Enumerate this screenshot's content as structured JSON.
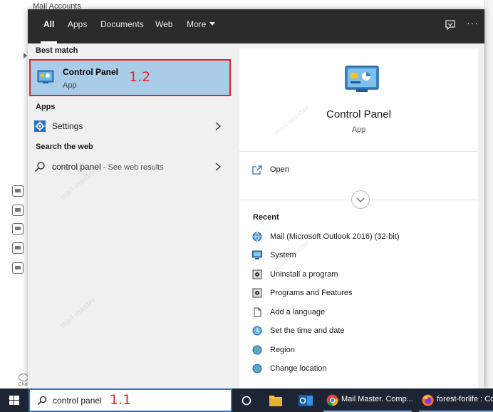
{
  "background": {
    "window_title": "Mail Accounts",
    "chat_label": "Chat"
  },
  "topbar": {
    "tabs": [
      {
        "label": "All",
        "active": true
      },
      {
        "label": "Apps",
        "active": false
      },
      {
        "label": "Documents",
        "active": false
      },
      {
        "label": "Web",
        "active": false
      },
      {
        "label": "More",
        "active": false
      }
    ],
    "feedback_icon": "feedback-icon",
    "more_options_icon": "ellipsis-icon",
    "more_options_glyph": "···"
  },
  "left": {
    "best_match_header": "Best match",
    "best_match": {
      "title": "Control Panel",
      "subtitle": "App",
      "icon": "control-panel-icon"
    },
    "apps_header": "Apps",
    "apps": [
      {
        "label": "Settings",
        "icon": "settings-gear-icon"
      }
    ],
    "web_header": "Search the web",
    "web": [
      {
        "label": "control panel",
        "suffix": " - See web results",
        "icon": "search-icon"
      }
    ]
  },
  "right": {
    "app_title": "Control Panel",
    "app_subtitle": "App",
    "open_label": "Open",
    "recent_header": "Recent",
    "recent": [
      {
        "label": "Mail (Microsoft Outlook 2016) (32-bit)",
        "icon": "mail-globe-icon"
      },
      {
        "label": "System",
        "icon": "system-monitor-icon"
      },
      {
        "label": "Uninstall a program",
        "icon": "programs-icon"
      },
      {
        "label": "Programs and Features",
        "icon": "programs-icon"
      },
      {
        "label": "Add a language",
        "icon": "document-icon"
      },
      {
        "label": "Set the time and date",
        "icon": "clock-globe-icon"
      },
      {
        "label": "Region",
        "icon": "globe-icon"
      },
      {
        "label": "Change location",
        "icon": "globe-icon"
      }
    ]
  },
  "annotations": {
    "step_best_match": "1.2",
    "step_search": "1.1"
  },
  "taskbar": {
    "search_value": "control panel",
    "apps": [
      {
        "label": "Mail Master. Comp...",
        "icon": "chrome-icon"
      },
      {
        "label": "forest-forlife : Co",
        "icon": "firefox-icon"
      }
    ]
  },
  "colors": {
    "highlight": "#a9cce8",
    "annotation_red": "#e52322",
    "taskbar": "#1d2433",
    "topbar": "#2b2b2b",
    "search_border": "#2e73c9"
  },
  "watermark": "mail master"
}
